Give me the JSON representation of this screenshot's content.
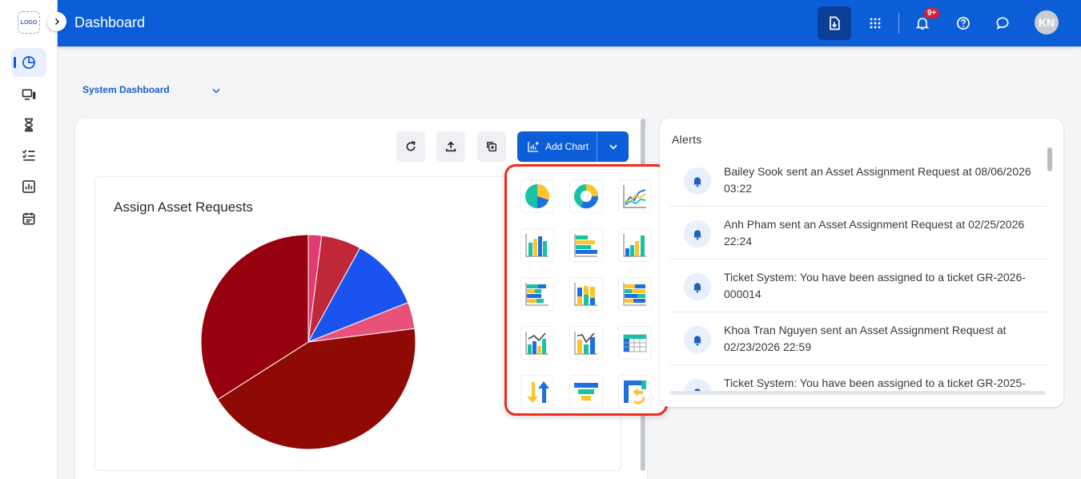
{
  "sidebar": {
    "logo_text": "LOGO",
    "items": [
      {
        "icon": "pie-chart-icon",
        "active": true
      },
      {
        "icon": "devices-icon",
        "active": false
      },
      {
        "icon": "hourglass-icon",
        "active": false
      },
      {
        "icon": "checklist-icon",
        "active": false
      },
      {
        "icon": "bar-report-icon",
        "active": false
      },
      {
        "icon": "calendar-icon",
        "active": false
      }
    ]
  },
  "header": {
    "title": "Dashboard",
    "notification_badge": "9+",
    "avatar_initials": "KN",
    "brand_color": "#0b5ed7"
  },
  "dashboard_selector": {
    "value": "System Dashboard"
  },
  "toolbar": {
    "add_chart_label": "Add Chart"
  },
  "chart": {
    "title": "Assign Asset Requests"
  },
  "chart_data": {
    "type": "pie",
    "title": "Assign Asset Requests",
    "values": [
      2,
      6,
      11,
      4,
      43,
      34
    ],
    "colors": [
      "#e23b74",
      "#c0283a",
      "#1a53f0",
      "#e8527a",
      "#8f0a05",
      "#97000e"
    ],
    "legend": "none"
  },
  "chart_picker": {
    "items": [
      "pie-chart-icon",
      "donut-chart-icon",
      "line-chart-icon",
      "bar-chart-icon",
      "horizontal-bar-chart-icon",
      "grouped-bar-chart-icon",
      "stacked-horizontal-bar-icon",
      "stacked-bar-chart-icon",
      "stacked-horizontal-bar-100-icon",
      "combo-chart-icon",
      "combo-bar-line-icon",
      "table-chart-icon",
      "up-down-arrows-icon",
      "funnel-chart-icon",
      "flow-exchange-icon"
    ]
  },
  "alerts": {
    "title": "Alerts",
    "items": [
      {
        "text": "Bailey Sook sent an Asset Assignment Request at 08/06/2026 03:22"
      },
      {
        "text": "Anh Pham sent an Asset Assignment Request at 02/25/2026 22:24"
      },
      {
        "text": "Ticket System: You have been assigned to a ticket GR-2026-000014"
      },
      {
        "text": "Khoa Tran Nguyen sent an Asset Assignment Request at 02/23/2026 22:59"
      },
      {
        "text": "Ticket System: You have been assigned to a ticket GR-2025-"
      }
    ]
  }
}
